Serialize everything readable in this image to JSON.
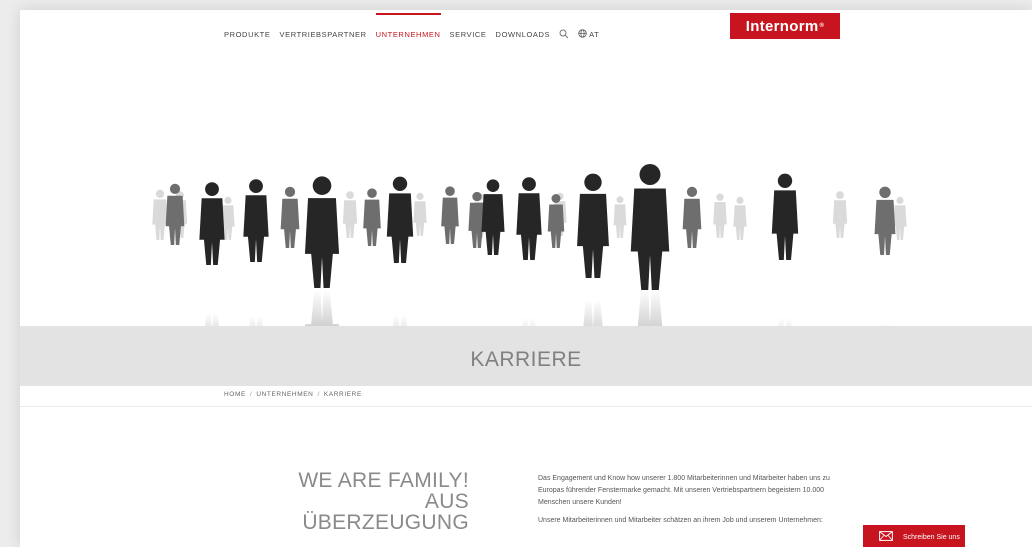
{
  "nav": {
    "items": [
      {
        "label": "PRODUKTE",
        "active": false
      },
      {
        "label": "VERTRIEBSPARTNER",
        "active": false
      },
      {
        "label": "UNTERNEHMEN",
        "active": true
      },
      {
        "label": "SERVICE",
        "active": false
      },
      {
        "label": "DOWNLOADS",
        "active": false
      }
    ],
    "search_icon": "search-icon",
    "lang_icon": "globe-icon",
    "lang_label": "AT"
  },
  "logo": {
    "text": "Internorm",
    "mark": "®"
  },
  "hero": {
    "image": "silhouettes-of-people-standing-on-reflective-floor"
  },
  "page": {
    "title": "KARRIERE"
  },
  "breadcrumb": {
    "items": [
      "HOME",
      "UNTERNEHMEN",
      "KARRIERE"
    ],
    "separator": "/"
  },
  "content": {
    "headline": [
      "WE ARE FAMILY!",
      "AUS",
      "ÜBERZEUGUNG"
    ],
    "paragraphs": [
      "Das Engagement und Know how unserer 1.800 Mitarbeiterinnen und Mitarbeiter haben uns zu Europas führender Fenstermarke gemacht. Mit unseren Vertriebspartnern begeistern 10.000 Menschen unsere Kunden!",
      "Unsere Mitarbeiterinnen und Mitarbeiter schätzen an ihrem Job und unserem Unternehmen:"
    ]
  },
  "contact": {
    "label": "Schreiben Sie uns",
    "icon": "mail-icon"
  },
  "colors": {
    "brand": "#c8141e",
    "band": "#e3e3e3",
    "text": "#555555"
  }
}
